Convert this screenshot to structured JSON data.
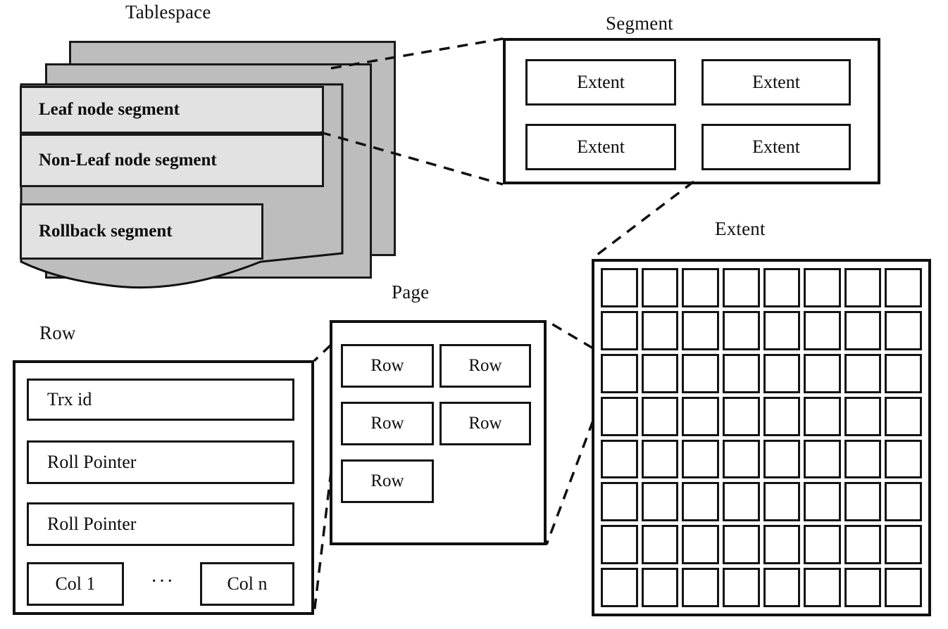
{
  "diagram": {
    "title_tablespace": "Tablespace",
    "title_segment": "Segment",
    "title_extent": "Extent",
    "title_page": "Page",
    "title_row": "Row"
  },
  "tablespace": {
    "label": "Tablespace",
    "card_count": 3,
    "segments": [
      {
        "label": "Leaf node segment"
      },
      {
        "label": "Non-Leaf node segment"
      },
      {
        "label": "Rollback segment"
      }
    ]
  },
  "segment": {
    "label": "Segment",
    "extents": [
      {
        "label": "Extent"
      },
      {
        "label": "Extent"
      },
      {
        "label": "Extent"
      },
      {
        "label": "Extent"
      }
    ]
  },
  "extent": {
    "label": "Extent",
    "grid_columns": 8,
    "grid_rows": 8,
    "page_count": 64
  },
  "page": {
    "label": "Page",
    "rows": [
      {
        "label": "Row"
      },
      {
        "label": "Row"
      },
      {
        "label": "Row"
      },
      {
        "label": "Row"
      },
      {
        "label": "Row"
      }
    ]
  },
  "row": {
    "label": "Row",
    "fields": [
      {
        "label": "Trx id"
      },
      {
        "label": "Roll Pointer"
      },
      {
        "label": "Roll Pointer"
      }
    ],
    "columns": {
      "first": "Col 1",
      "ellipsis": "···",
      "last": "Col n"
    }
  },
  "colors": {
    "stroke": "#101010",
    "card_back": "#bdbdbd",
    "card_band": "#e2e2e2",
    "background": "#ffffff"
  }
}
